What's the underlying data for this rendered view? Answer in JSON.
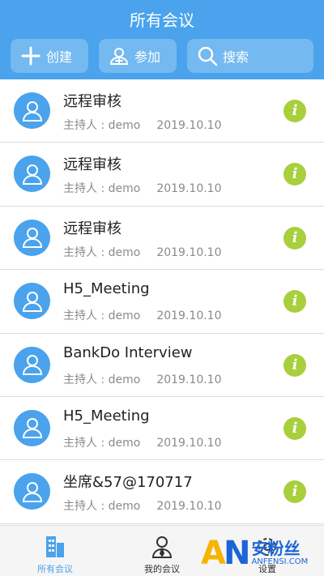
{
  "header": {
    "title": "所有会议",
    "buttons": [
      {
        "label": "创建",
        "icon": "plus-icon"
      },
      {
        "label": "参加",
        "icon": "join-person-icon"
      },
      {
        "label": "搜索",
        "icon": "search-icon"
      }
    ]
  },
  "meetings": [
    {
      "title": "远程审核",
      "host": "主持人 : demo",
      "date": "2019.10.10"
    },
    {
      "title": "远程审核",
      "host": "主持人 : demo",
      "date": "2019.10.10"
    },
    {
      "title": "远程审核",
      "host": "主持人 : demo",
      "date": "2019.10.10"
    },
    {
      "title": "H5_Meeting",
      "host": "主持人 : demo",
      "date": "2019.10.10"
    },
    {
      "title": "BankDo Interview",
      "host": "主持人 : demo",
      "date": "2019.10.10"
    },
    {
      "title": "H5_Meeting",
      "host": "主持人 : demo",
      "date": "2019.10.10"
    },
    {
      "title": "坐席&57@170717",
      "host": "主持人 : demo",
      "date": "2019.10.10"
    }
  ],
  "tabs": [
    {
      "label": "所有会议",
      "icon": "building-icon",
      "active": true
    },
    {
      "label": "我的会议",
      "icon": "person-icon",
      "active": false
    },
    {
      "label": "设置",
      "icon": "gear-icon",
      "active": false
    }
  ],
  "watermark": {
    "logo": "AN",
    "text_cn": "安粉丝",
    "text_en": "ANFENSI.COM"
  },
  "colors": {
    "primary": "#4aa3ec",
    "info": "#a8cf3c"
  }
}
